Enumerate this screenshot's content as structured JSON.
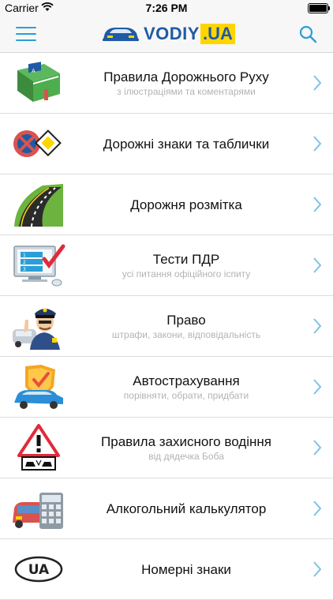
{
  "status_bar": {
    "carrier": "Carrier",
    "time": "7:26 PM"
  },
  "header": {
    "logo_main": "VODIY",
    "logo_suffix": ".UA"
  },
  "menu": [
    {
      "title": "Правила Дорожнього Руху",
      "subtitle": "з ілюстраціями та коментарями",
      "icon": "rules-book-icon"
    },
    {
      "title": "Дорожні знаки та таблички",
      "subtitle": "",
      "icon": "road-signs-icon"
    },
    {
      "title": "Дорожня розмітка",
      "subtitle": "",
      "icon": "road-marking-icon"
    },
    {
      "title": "Тести ПДР",
      "subtitle": "усі питання офіційного іспиту",
      "icon": "test-monitor-icon"
    },
    {
      "title": "Право",
      "subtitle": "штрафи, закони, відповідальність",
      "icon": "police-officer-icon"
    },
    {
      "title": "Автострахування",
      "subtitle": "порівняти, обрати, придбати",
      "icon": "insurance-car-icon"
    },
    {
      "title": "Правила захисного водіння",
      "subtitle": "від дядечка Боба",
      "icon": "defensive-driving-icon"
    },
    {
      "title": "Алкогольний калькулятор",
      "subtitle": "",
      "icon": "alcohol-calculator-icon"
    },
    {
      "title": "Номерні знаки",
      "subtitle": "",
      "icon": "plate-ua-icon",
      "icon_text": "UA"
    }
  ],
  "colors": {
    "accent": "#2a9fd6",
    "logo_blue": "#1f5aa5",
    "logo_yellow": "#ffd500"
  }
}
